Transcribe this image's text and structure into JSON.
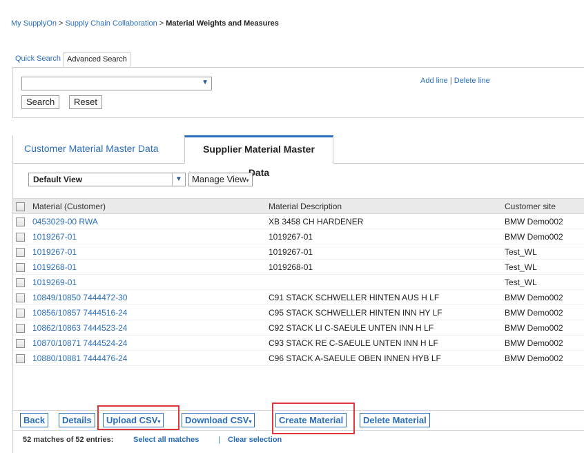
{
  "breadcrumb": {
    "items": [
      "My SupplyOn",
      "Supply Chain Collaboration"
    ],
    "separator": ">",
    "current": "Material Weights and Measures"
  },
  "search": {
    "tabs": [
      "Quick Search",
      "Advanced Search"
    ],
    "field_value": "",
    "search_label": "Search",
    "reset_label": "Reset",
    "add_line": "Add line",
    "line_sep": "|",
    "delete_line": "Delete line"
  },
  "material_tabs": {
    "customer": "Customer Material Master Data",
    "supplier": "Supplier Material Master Data"
  },
  "view": {
    "selected": "Default View",
    "manage_label": "Manage View",
    "caret": "▾"
  },
  "table": {
    "columns": [
      "Material (Customer)",
      "Material Description",
      "Customer site"
    ],
    "rows": [
      [
        "0453029-00 RWA",
        "XB 3458 CH HARDENER",
        "BMW Demo002"
      ],
      [
        "1019267-01",
        "1019267-01",
        "BMW Demo002"
      ],
      [
        "1019267-01",
        "1019267-01",
        "Test_WL"
      ],
      [
        "1019268-01",
        "1019268-01",
        "Test_WL"
      ],
      [
        "1019269-01",
        "",
        "Test_WL"
      ],
      [
        "10849/10850 7444472-30",
        "C91 STACK SCHWELLER HINTEN AUS H LF",
        "BMW Demo002"
      ],
      [
        "10856/10857 7444516-24",
        "C95 STACK SCHWELLER HINTEN INN HY LF",
        "BMW Demo002"
      ],
      [
        "10862/10863 7444523-24",
        "C92 STACK LI C-SAEULE UNTEN INN H LF",
        "BMW Demo002"
      ],
      [
        "10870/10871 7444524-24",
        "C93 STACK RE C-SAEULE UNTEN INN H LF",
        "BMW Demo002"
      ],
      [
        "10880/10881 7444476-24",
        "C96 STACK A-SAEULE OBEN INNEN HYB LF",
        "BMW Demo002"
      ]
    ]
  },
  "actions": {
    "back": "Back",
    "details": "Details",
    "upload_csv": "Upload CSV",
    "download_csv": "Download CSV",
    "create_material": "Create Material",
    "delete_material": "Delete Material",
    "caret": "▾"
  },
  "footer": {
    "count": "52 matches of 52 entries:",
    "select_all": "Select all matches",
    "separator": "|",
    "clear": "Clear selection"
  },
  "colors": {
    "link": "#2a6ebb",
    "highlight": "#e0353a",
    "header_bg": "#eaeaea"
  }
}
